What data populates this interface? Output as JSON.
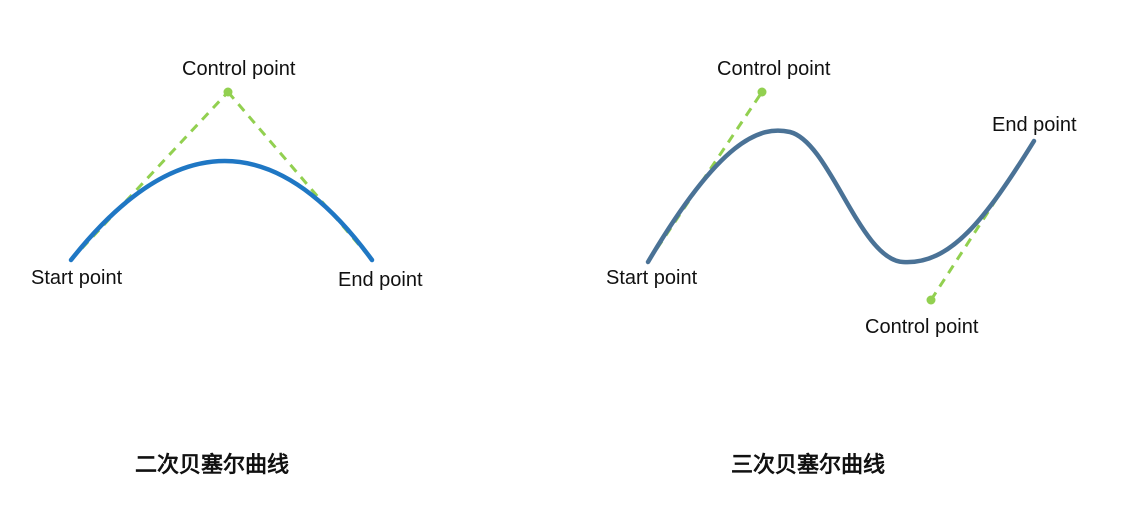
{
  "quadratic": {
    "labels": {
      "start": "Start point",
      "control": "Control point",
      "end": "End point"
    },
    "caption": "二次贝塞尔曲线"
  },
  "cubic": {
    "labels": {
      "start": "Start point",
      "control1": "Control point",
      "control2": "Control point",
      "end": "End point"
    },
    "caption": "三次贝塞尔曲线"
  },
  "colors": {
    "quadratic_curve": "#1f77c4",
    "cubic_curve": "#4a7296",
    "control_lines": "#92d050",
    "control_points": "#92d050"
  }
}
